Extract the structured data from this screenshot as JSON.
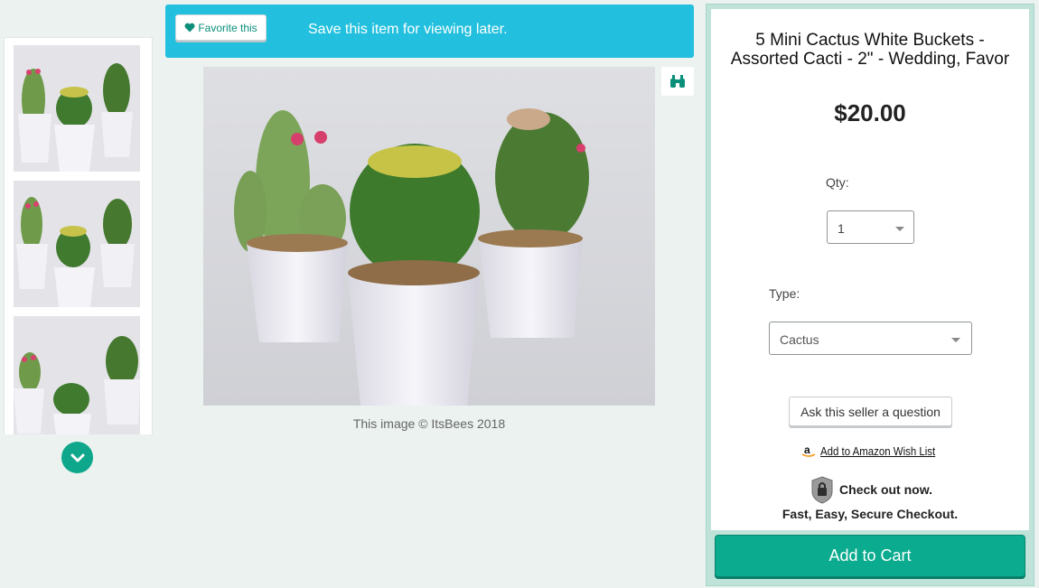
{
  "favorite_bar": {
    "button_label": "Favorite this",
    "message": "Save this item for viewing later."
  },
  "gallery": {
    "thumbnails": [
      {
        "alt": "cactus-photo-1"
      },
      {
        "alt": "cactus-photo-2"
      },
      {
        "alt": "cactus-photo-3"
      }
    ],
    "image_credit": "This image © ItsBees 2018"
  },
  "product": {
    "title": "5 Mini Cactus White Buckets - Assorted Cacti - 2\" - Wedding, Favor",
    "price": "$20.00",
    "qty_label": "Qty:",
    "qty_value": "1",
    "type_label": "Type:",
    "type_value": "Cactus",
    "ask_seller_label": "Ask this seller a question",
    "wishlist_label": "Add to Amazon Wish List",
    "checkout_line1": "Check out now.",
    "checkout_line2": "Fast, Easy, Secure Checkout.",
    "add_to_cart_label": "Add to Cart"
  },
  "colors": {
    "accent": "#0aab8f",
    "banner": "#22c0de",
    "panel_border": "#bfe3d9",
    "background": "#ebf2ef"
  },
  "icons": [
    "heart-icon",
    "binoculars-icon",
    "chevron-down-icon",
    "amazon-icon",
    "lock-badge-icon",
    "caret-down-icon"
  ]
}
